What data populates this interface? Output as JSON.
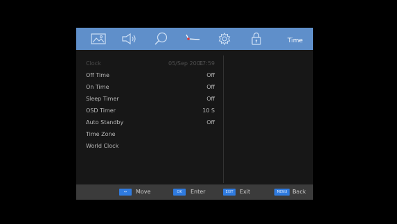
{
  "tabs": [
    {
      "icon": "picture-icon"
    },
    {
      "icon": "speaker-icon"
    },
    {
      "icon": "search-icon"
    },
    {
      "icon": "clock-hands-icon"
    },
    {
      "icon": "gear-icon"
    },
    {
      "icon": "lock-icon"
    }
  ],
  "active_tab_label": "Time",
  "menu": {
    "clock": {
      "label": "Clock",
      "date": "05/Sep 2001",
      "time": "17:59"
    },
    "off_time": {
      "label": "Off Time",
      "value": "Off"
    },
    "on_time": {
      "label": "On Time",
      "value": "Off"
    },
    "sleep_timer": {
      "label": "Sleep Timer",
      "value": "Off"
    },
    "osd_timer": {
      "label": "OSD Timer",
      "value": "10 S"
    },
    "auto_standby": {
      "label": "Auto Standby",
      "value": "Off"
    },
    "time_zone": {
      "label": "Time Zone"
    },
    "world_clock": {
      "label": "World Clock"
    }
  },
  "footer": {
    "move": {
      "key": "↔",
      "label": "Move"
    },
    "enter": {
      "key": "OK",
      "label": "Enter"
    },
    "exit": {
      "key": "EXIT",
      "label": "Exit"
    },
    "back": {
      "key": "MENU",
      "label": "Back"
    }
  },
  "colors": {
    "tab_bar": "#5f8fca",
    "panel": "#171717",
    "footer_bar": "#3b3b3b",
    "key_button": "#2f7be0"
  }
}
